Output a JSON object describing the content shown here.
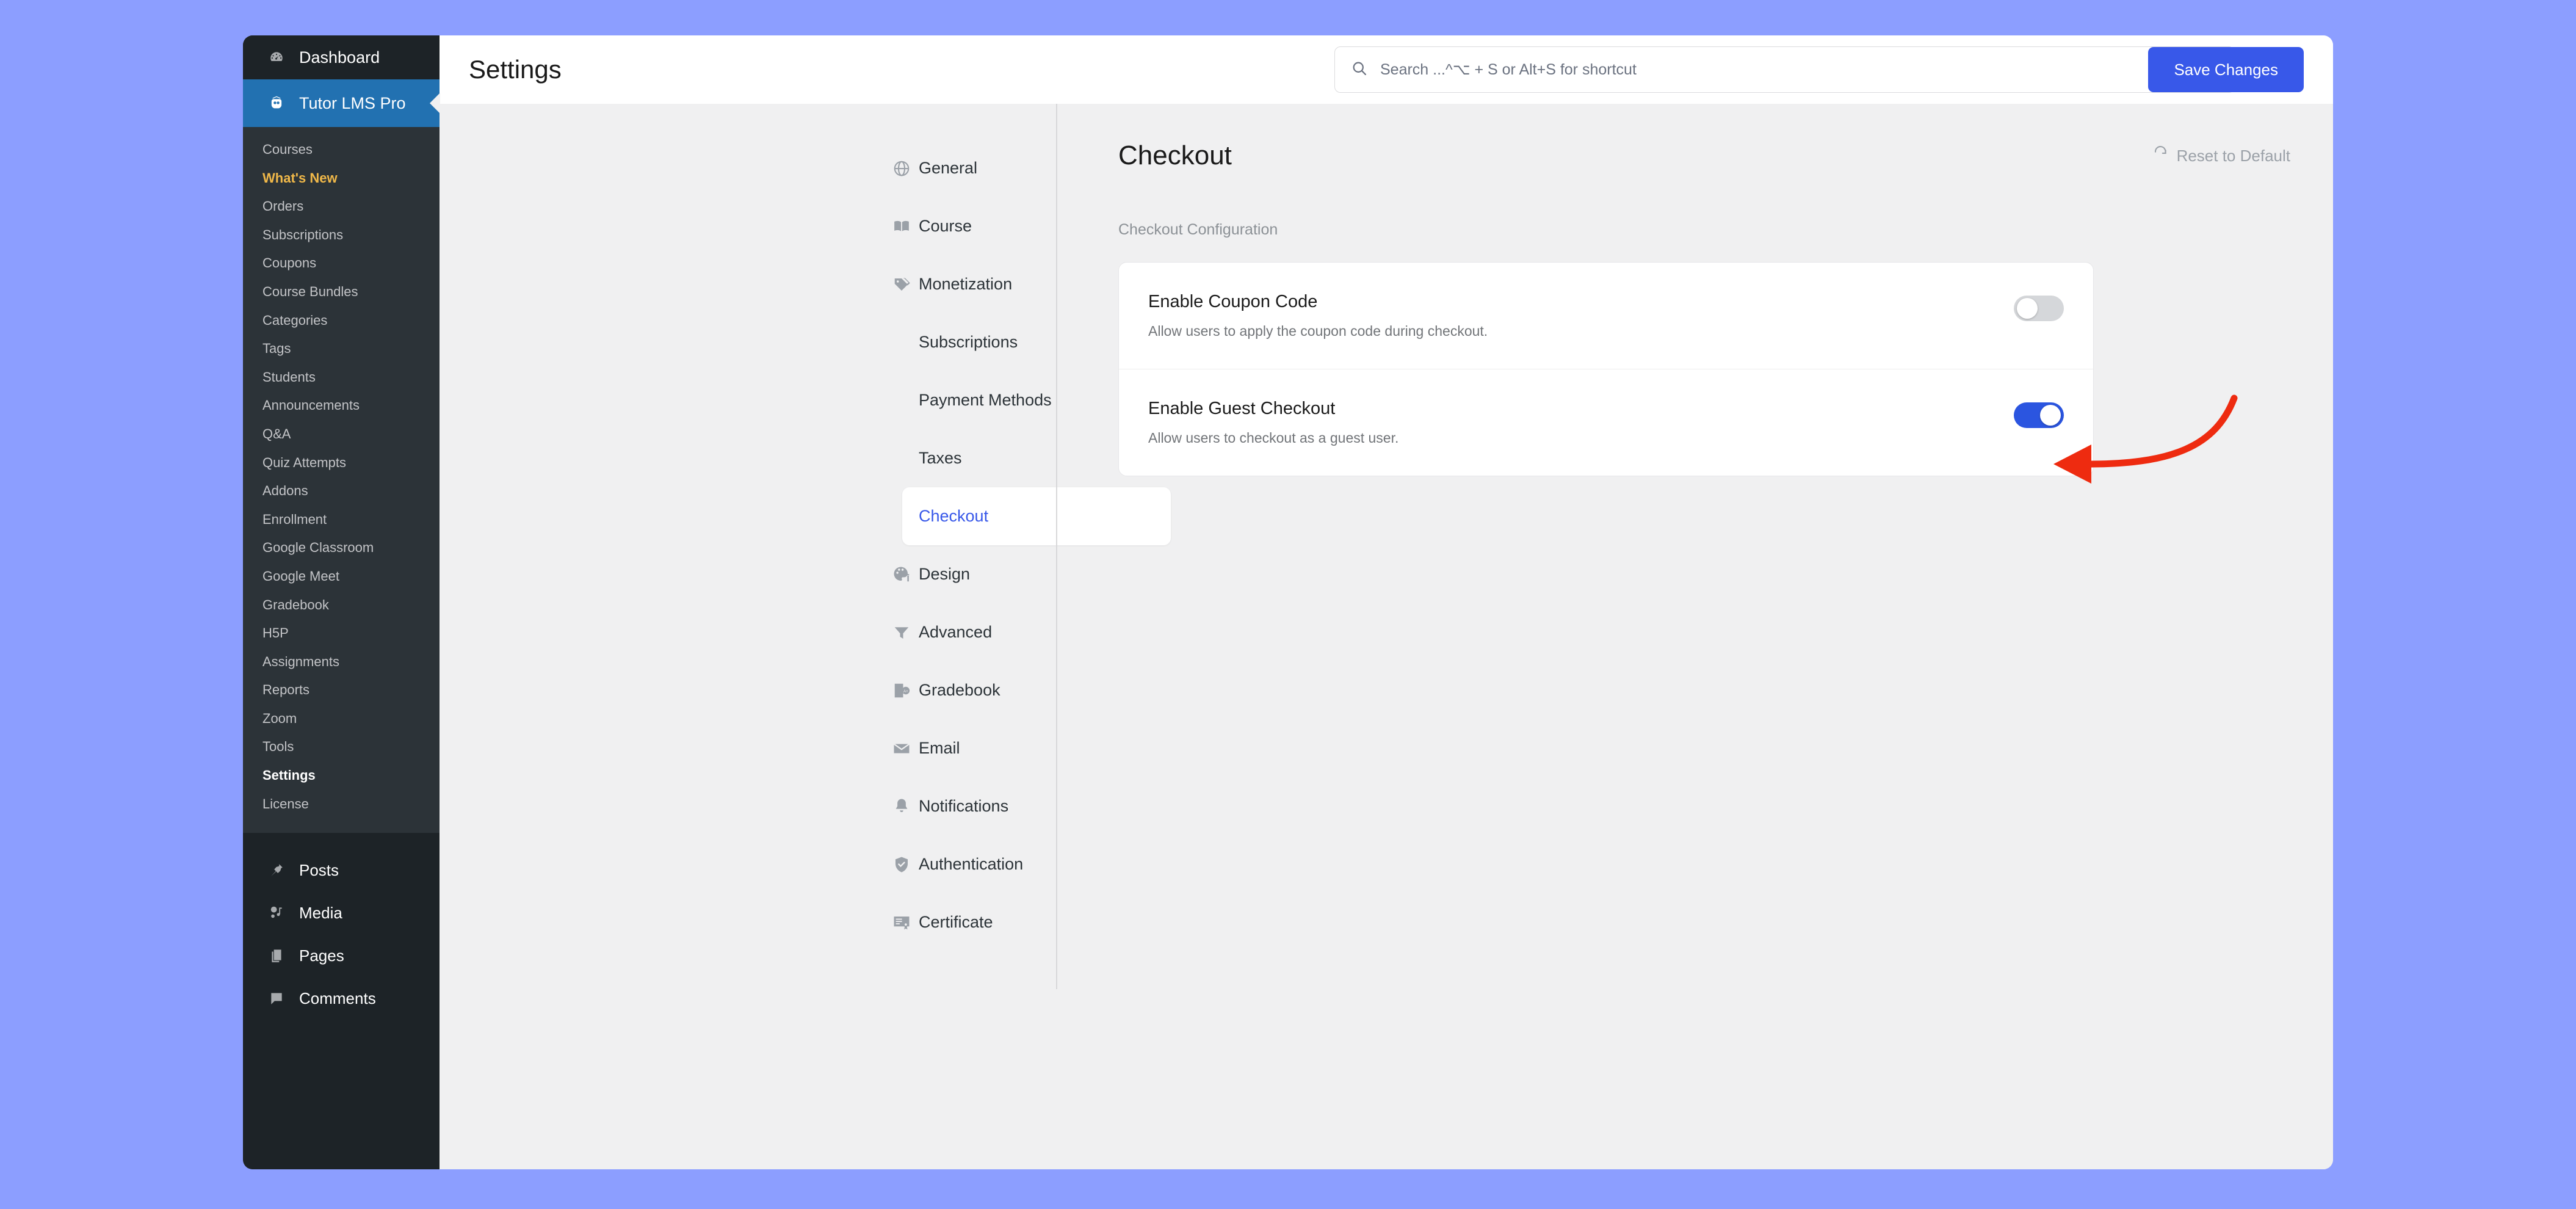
{
  "theme": {
    "page_bg": "#8c9eff",
    "accent_blue": "#3858e9",
    "wp_sidebar_bg": "#1d2327",
    "wp_submenu_bg": "#2c3338",
    "wp_brand_bg": "#2271b1",
    "accent_yellow": "#f0b849",
    "toggle_on": "#2b55e0",
    "toggle_off": "#d5d7da",
    "annotation_red": "#ee2b10"
  },
  "wp_sidebar": {
    "top_items": [
      {
        "label": "Dashboard",
        "icon": "dashboard-icon"
      }
    ],
    "brand": {
      "label": "Tutor LMS Pro",
      "icon": "tutor-owl-icon"
    },
    "submenu": [
      {
        "label": "Courses",
        "state": "normal"
      },
      {
        "label": "What's New",
        "state": "accent"
      },
      {
        "label": "Orders",
        "state": "normal"
      },
      {
        "label": "Subscriptions",
        "state": "normal"
      },
      {
        "label": "Coupons",
        "state": "normal"
      },
      {
        "label": "Course Bundles",
        "state": "normal"
      },
      {
        "label": "Categories",
        "state": "normal"
      },
      {
        "label": "Tags",
        "state": "normal"
      },
      {
        "label": "Students",
        "state": "normal"
      },
      {
        "label": "Announcements",
        "state": "normal"
      },
      {
        "label": "Q&A",
        "state": "normal"
      },
      {
        "label": "Quiz Attempts",
        "state": "normal"
      },
      {
        "label": "Addons",
        "state": "normal"
      },
      {
        "label": "Enrollment",
        "state": "normal"
      },
      {
        "label": "Google Classroom",
        "state": "normal"
      },
      {
        "label": "Google Meet",
        "state": "normal"
      },
      {
        "label": "Gradebook",
        "state": "normal"
      },
      {
        "label": "H5P",
        "state": "normal"
      },
      {
        "label": "Assignments",
        "state": "normal"
      },
      {
        "label": "Reports",
        "state": "normal"
      },
      {
        "label": "Zoom",
        "state": "normal"
      },
      {
        "label": "Tools",
        "state": "normal"
      },
      {
        "label": "Settings",
        "state": "current"
      },
      {
        "label": "License",
        "state": "normal"
      }
    ],
    "lower_items": [
      {
        "label": "Posts",
        "icon": "pin-icon"
      },
      {
        "label": "Media",
        "icon": "media-icon"
      },
      {
        "label": "Pages",
        "icon": "pages-icon"
      },
      {
        "label": "Comments",
        "icon": "comment-icon"
      }
    ]
  },
  "topbar": {
    "title": "Settings",
    "search": {
      "icon": "search-icon",
      "placeholder": "Search ...^⌥ + S or Alt+S for shortcut",
      "value": ""
    },
    "save_label": "Save Changes"
  },
  "settings_nav": [
    {
      "label": "General",
      "icon": "globe-icon",
      "type": "top",
      "selected": false
    },
    {
      "label": "Course",
      "icon": "book-icon",
      "type": "top",
      "selected": false
    },
    {
      "label": "Monetization",
      "icon": "tag-percent-icon",
      "type": "top",
      "selected": false
    },
    {
      "label": "Subscriptions",
      "icon": "",
      "type": "sub",
      "selected": false
    },
    {
      "label": "Payment Methods",
      "icon": "",
      "type": "sub",
      "selected": false
    },
    {
      "label": "Taxes",
      "icon": "",
      "type": "sub",
      "selected": false
    },
    {
      "label": "Checkout",
      "icon": "",
      "type": "sub",
      "selected": true
    },
    {
      "label": "Design",
      "icon": "palette-icon",
      "type": "top",
      "selected": false
    },
    {
      "label": "Advanced",
      "icon": "funnel-icon",
      "type": "top",
      "selected": false
    },
    {
      "label": "Gradebook",
      "icon": "gradebook-icon",
      "type": "top",
      "selected": false
    },
    {
      "label": "Email",
      "icon": "envelope-icon",
      "type": "top",
      "selected": false
    },
    {
      "label": "Notifications",
      "icon": "bell-icon",
      "type": "top",
      "selected": false
    },
    {
      "label": "Authentication",
      "icon": "shield-check-icon",
      "type": "top",
      "selected": false
    },
    {
      "label": "Certificate",
      "icon": "certificate-icon",
      "type": "top",
      "selected": false
    }
  ],
  "main": {
    "title": "Checkout",
    "reset": {
      "label": "Reset to Default",
      "icon": "refresh-icon"
    },
    "section_label": "Checkout Configuration",
    "settings": [
      {
        "label": "Enable Coupon Code",
        "description": "Allow users to apply the coupon code during checkout.",
        "toggle": "off"
      },
      {
        "label": "Enable Guest Checkout",
        "description": "Allow users to checkout as a guest user.",
        "toggle": "on"
      }
    ]
  },
  "annotation": {
    "type": "curved-arrow",
    "color": "#ee2b10",
    "points_at": "Enable Guest Checkout toggle"
  }
}
